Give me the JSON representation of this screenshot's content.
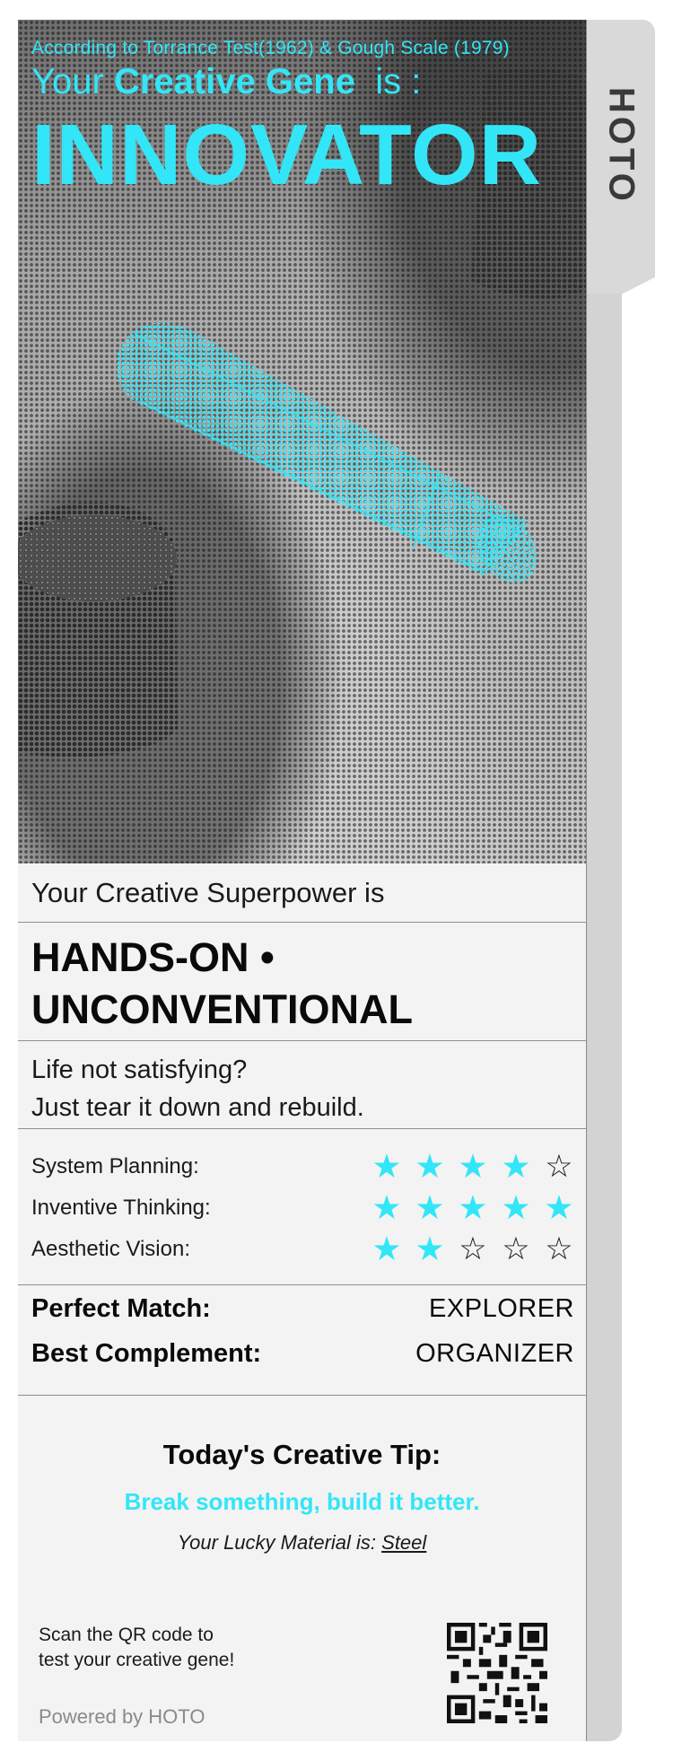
{
  "side_tab": {
    "brand": "HOTO"
  },
  "hero": {
    "subtitle": "According to Torrance Test(1962) & Gough Scale (1979)",
    "line_prefix": "Your ",
    "line_bold": "Creative Gene",
    "line_suffix": "  is :",
    "gene_type": "INNOVATOR"
  },
  "superpower": {
    "label": "Your Creative Superpower is",
    "value": "HANDS-ON • UNCONVENTIONAL"
  },
  "tagline": {
    "line1": "Life not satisfying?",
    "line2": "Just tear it down and rebuild."
  },
  "ratings": [
    {
      "label": "System Planning:",
      "stars": 4,
      "max": 5
    },
    {
      "label": "Inventive Thinking:",
      "stars": 5,
      "max": 5
    },
    {
      "label": "Aesthetic Vision:",
      "stars": 2,
      "max": 5
    }
  ],
  "matches": {
    "perfect_label": "Perfect Match:",
    "perfect_value": "EXPLORER",
    "complement_label": "Best Complement:",
    "complement_value": "ORGANIZER"
  },
  "tip": {
    "title": "Today's Creative Tip:",
    "body": "Break something, build it better.",
    "lucky_prefix": "Your Lucky Material is: ",
    "lucky_material": "Steel"
  },
  "footer": {
    "scan_line1": "Scan the QR code to",
    "scan_line2": "test your creative gene!",
    "powered_by": "Powered by HOTO"
  },
  "colors": {
    "accent": "#32e6f7",
    "text": "#0a0a0a",
    "card_bg": "#f3f3f3",
    "tab_bg": "#d9d9d9",
    "muted": "#8a8a8a"
  },
  "icons": {
    "rating_on": "star-filled-icon",
    "rating_off": "star-outline-icon",
    "qr": "qr-code-icon"
  }
}
